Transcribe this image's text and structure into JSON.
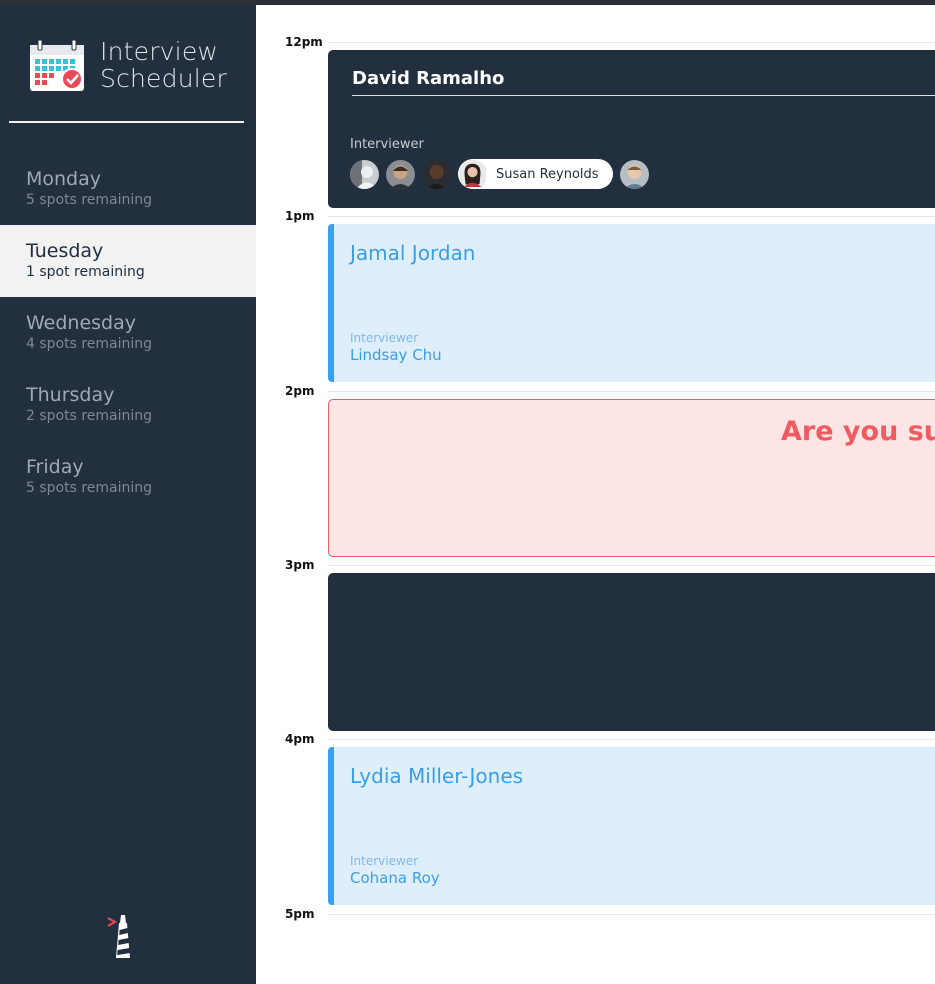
{
  "app": {
    "title_line1": "Interview",
    "title_line2": "Scheduler",
    "logo_icon": "calendar-check-icon",
    "footer_icon": "lighthouse-icon"
  },
  "days": [
    {
      "name": "Monday",
      "spots": "5 spots remaining",
      "selected": false
    },
    {
      "name": "Tuesday",
      "spots": "1 spot remaining",
      "selected": true
    },
    {
      "name": "Wednesday",
      "spots": "4 spots remaining",
      "selected": false
    },
    {
      "name": "Thursday",
      "spots": "2 spots remaining",
      "selected": false
    },
    {
      "name": "Friday",
      "spots": "5 spots remaining",
      "selected": false
    }
  ],
  "times": [
    "12pm",
    "1pm",
    "2pm",
    "3pm",
    "4pm",
    "5pm"
  ],
  "edit_form": {
    "student_value": "David Ramalho",
    "interviewer_label": "Interviewer",
    "selected_interviewer": "Susan Reynolds"
  },
  "appointments": [
    {
      "student": "Jamal Jordan",
      "interviewer_label": "Interviewer",
      "interviewer": "Lindsay Chu"
    },
    {
      "student": "Lydia Miller-Jones",
      "interviewer_label": "Interviewer",
      "interviewer": "Cohana Roy"
    }
  ],
  "confirm": {
    "message": "Are you sure"
  },
  "colors": {
    "sidebar_bg": "#222f3e",
    "selected_day_bg": "#f2f2f2",
    "booked_bg": "#dfeefb",
    "booked_accent": "#38a0f0",
    "confirm_bg": "#fde4e5",
    "confirm_text": "#ef5b60"
  }
}
